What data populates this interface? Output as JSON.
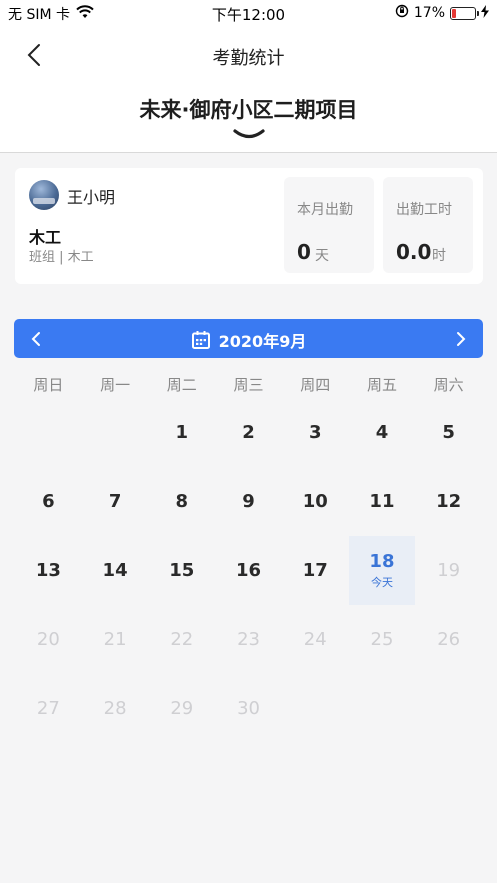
{
  "status_bar": {
    "carrier": "无 SIM 卡",
    "time": "下午12:00",
    "battery": "17%",
    "battery_level": 0.17
  },
  "nav": {
    "title": "考勤统计",
    "project": "未来·御府小区二期项目"
  },
  "profile": {
    "name": "王小明",
    "job": "木工",
    "group": "班组 | 木工"
  },
  "stats": {
    "month_attendance": {
      "label": "本月出勤",
      "value": "0",
      "unit": "天"
    },
    "work_hours": {
      "label": "出勤工时",
      "value": "0.0",
      "unit": "时"
    }
  },
  "calendar": {
    "month_label": "2020年9月",
    "weekdays": [
      "周日",
      "周一",
      "周二",
      "周三",
      "周四",
      "周五",
      "周六"
    ],
    "today_label": "今天",
    "today": 18,
    "first_weekday": 2,
    "days_in_month": 30
  },
  "colors": {
    "accent": "#3a7af2",
    "today_bg": "#e9eef6",
    "future_text": "#cfcfd2"
  }
}
